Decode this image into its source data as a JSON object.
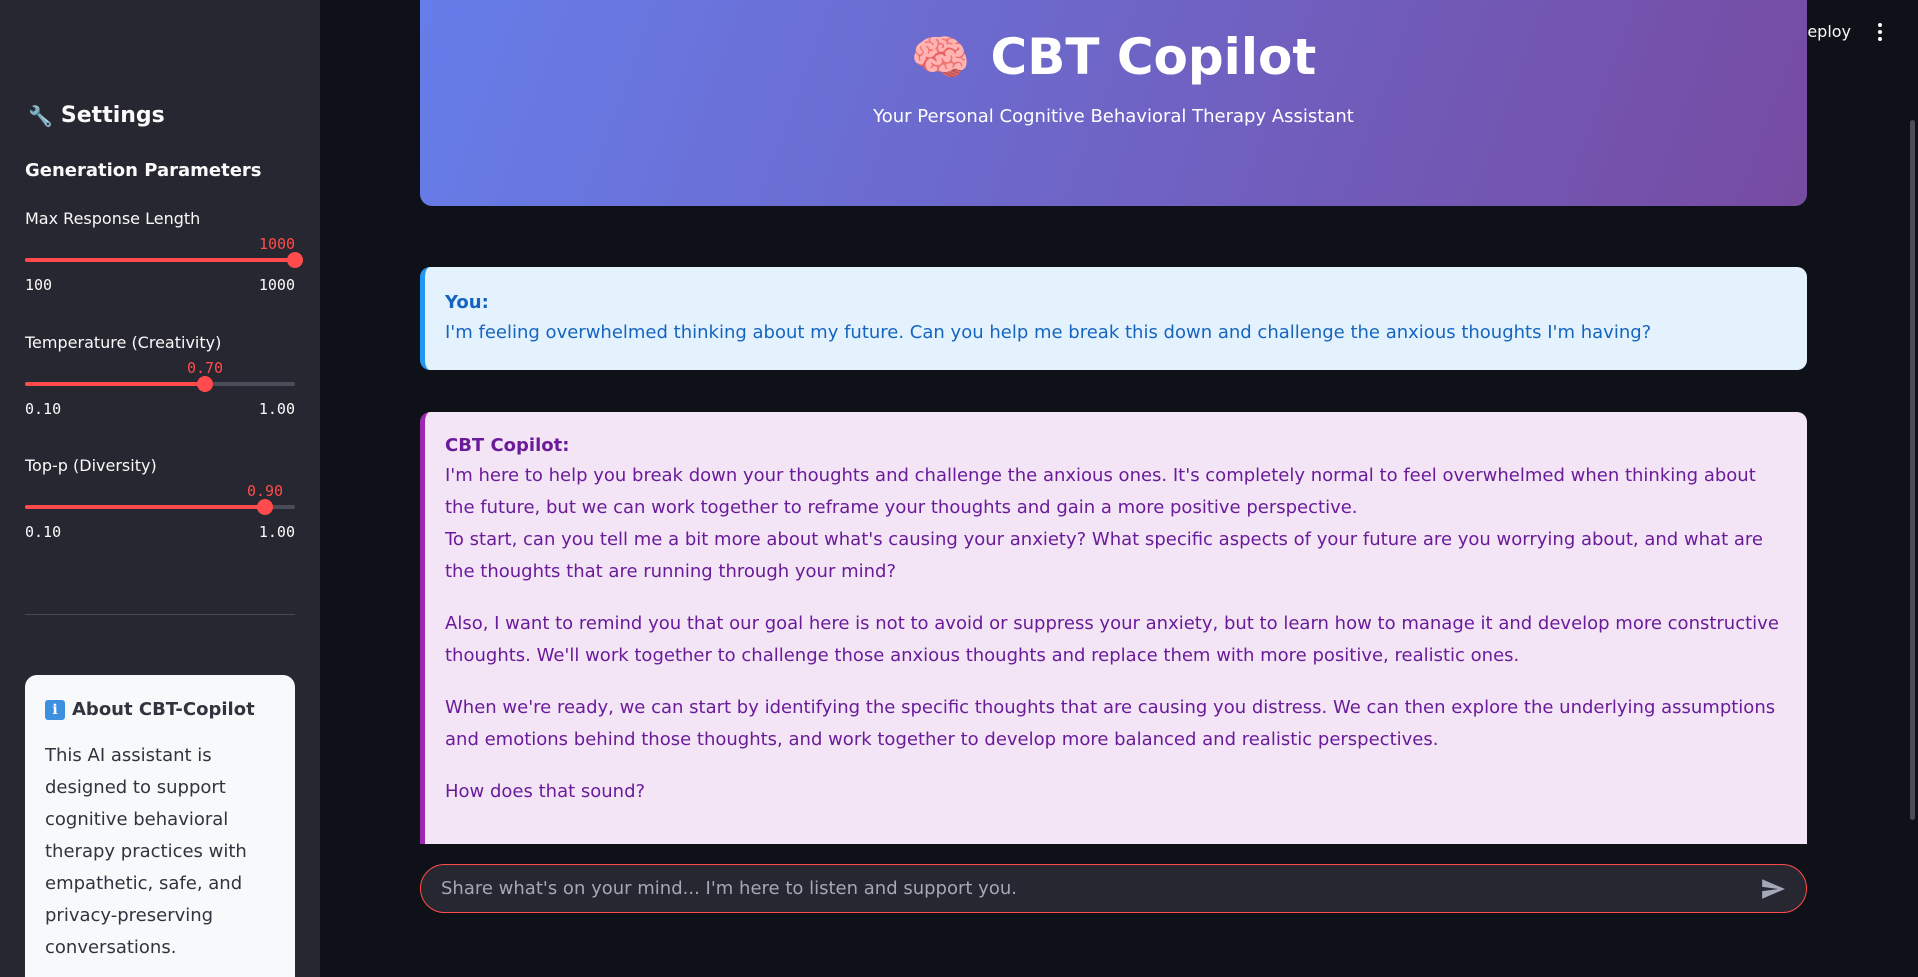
{
  "sidebar": {
    "title": "Settings",
    "title_icon": "wrench-icon",
    "section_heading": "Generation Parameters",
    "sliders": [
      {
        "label": "Max Response Length",
        "value_text": "1000",
        "value": 1000,
        "min": 100,
        "max": 1000,
        "min_text": "100",
        "max_text": "1000"
      },
      {
        "label": "Temperature (Creativity)",
        "value_text": "0.70",
        "value": 0.7,
        "min": 0.1,
        "max": 1.0,
        "min_text": "0.10",
        "max_text": "1.00"
      },
      {
        "label": "Top-p (Diversity)",
        "value_text": "0.90",
        "value": 0.9,
        "min": 0.1,
        "max": 1.0,
        "min_text": "0.10",
        "max_text": "1.00"
      }
    ],
    "about": {
      "title": "About CBT-Copilot",
      "icon": "info-icon",
      "text": "This AI assistant is designed to support cognitive behavioral therapy practices with empathetic, safe, and privacy-preserving conversations."
    }
  },
  "toolbar": {
    "deploy_label": "Deploy",
    "menu_icon": "kebab-menu-icon"
  },
  "header": {
    "title": "CBT Copilot",
    "icon": "brain-icon",
    "subtitle": "Your Personal Cognitive Behavioral Therapy Assistant"
  },
  "chat": {
    "user": {
      "who": "You:",
      "text": "I'm feeling overwhelmed thinking about my future. Can you help me break this down and challenge the anxious thoughts I'm having?"
    },
    "bot": {
      "who": "CBT Copilot:",
      "paragraphs": [
        "I'm here to help you break down your thoughts and challenge the anxious ones. It's completely normal to feel overwhelmed when thinking about the future, but we can work together to reframe your thoughts and gain a more positive perspective.",
        "To start, can you tell me a bit more about what's causing your anxiety? What specific aspects of your future are you worrying about, and what are the thoughts that are running through your mind?",
        "Also, I want to remind you that our goal here is not to avoid or suppress your anxiety, but to learn how to manage it and develop more constructive thoughts. We'll work together to challenge those anxious thoughts and replace them with more positive, realistic ones.",
        "When we're ready, we can start by identifying the specific thoughts that are causing you distress. We can then explore the underlying assumptions and emotions behind those thoughts, and work together to develop more balanced and realistic perspectives.",
        "How does that sound?"
      ]
    },
    "input": {
      "placeholder": "Share what's on your mind... I'm here to listen and support you.",
      "value": "",
      "send_icon": "send-icon"
    }
  },
  "colors": {
    "accent": "#ff4b4b",
    "sidebar_bg": "#262730",
    "app_bg": "#0e1117",
    "user_bubble": "#e3f2fd",
    "bot_bubble": "#f3e5f5",
    "banner_start": "#667eea",
    "banner_end": "#764ba2"
  }
}
